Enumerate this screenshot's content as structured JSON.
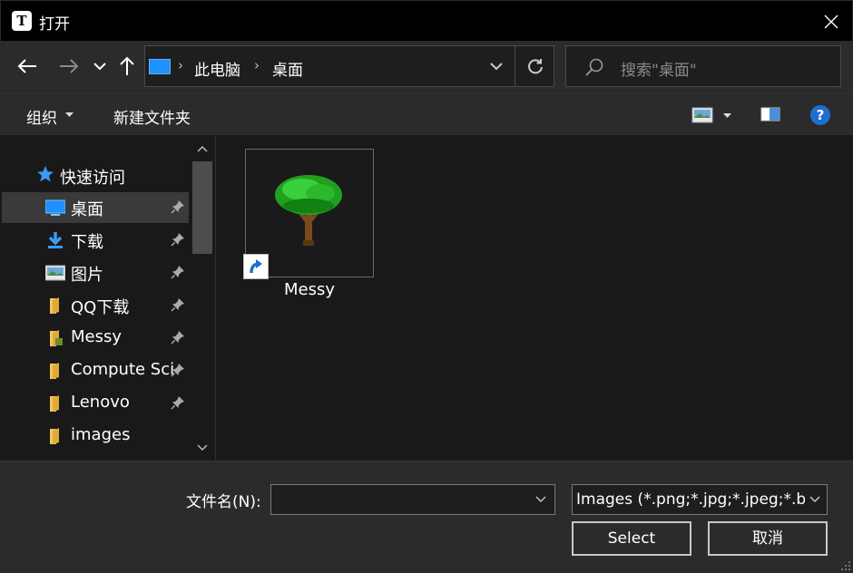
{
  "window": {
    "title": "打开",
    "app_icon_letter": "T"
  },
  "nav": {
    "breadcrumbs": [
      "此电脑",
      "桌面"
    ],
    "search_placeholder": "搜索\"桌面\""
  },
  "toolbar": {
    "organize_label": "组织",
    "new_folder_label": "新建文件夹"
  },
  "sidebar": {
    "quick_access_label": "快速访问",
    "items": [
      {
        "label": "桌面",
        "icon": "desktop-icon",
        "pinned": true,
        "selected": true
      },
      {
        "label": "下载",
        "icon": "download-icon",
        "pinned": true,
        "selected": false
      },
      {
        "label": "图片",
        "icon": "pictures-icon",
        "pinned": true,
        "selected": false
      },
      {
        "label": "QQ下载",
        "icon": "folder-icon",
        "pinned": true,
        "selected": false
      },
      {
        "label": "Messy",
        "icon": "folder-icon",
        "pinned": true,
        "selected": false
      },
      {
        "label": "Compute Sci",
        "icon": "folder-icon",
        "pinned": true,
        "selected": false
      },
      {
        "label": "Lenovo",
        "icon": "folder-icon",
        "pinned": true,
        "selected": false
      },
      {
        "label": "images",
        "icon": "folder-icon",
        "pinned": false,
        "selected": false
      }
    ]
  },
  "files": [
    {
      "name": "Messy",
      "type": "shortcut"
    }
  ],
  "bottom": {
    "filename_label": "文件名(N):",
    "filename_value": "",
    "filetype_value": "Images (*.png;*.jpg;*.jpeg;*.b",
    "select_label": "Select",
    "cancel_label": "取消"
  },
  "colors": {
    "background": "#191919",
    "panel": "#2b2b2b",
    "accent": "#1e90ff",
    "help": "#1f6fd1"
  }
}
